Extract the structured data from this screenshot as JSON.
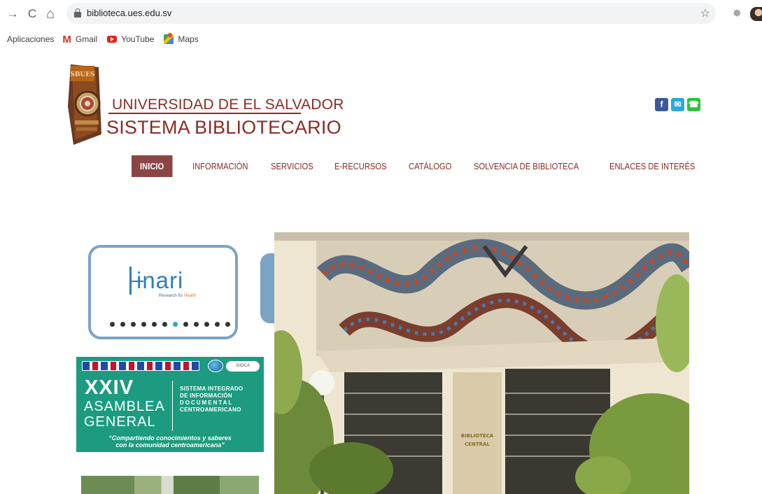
{
  "browser": {
    "url": "biblioteca.ues.edu.sv",
    "back_icon": "→",
    "reload_icon": "C",
    "home_icon": "⌂",
    "star_icon": "☆",
    "extension_icon": "✵"
  },
  "bookmarks": {
    "apps": "Aplicaciones",
    "gmail": "Gmail",
    "youtube": "YouTube",
    "maps": "Maps"
  },
  "header": {
    "line1": "UNIVERSIDAD DE EL SALVADOR",
    "line2": "SISTEMA BIBLIOTECARIO",
    "logo_text": "SBUES",
    "brand_color": "#8a2b23"
  },
  "social": {
    "facebook": "f",
    "mail": "✉",
    "phone": "☎"
  },
  "menu": [
    {
      "label": "INICIO",
      "active": true
    },
    {
      "label": "INFORMACIÓN",
      "active": false
    },
    {
      "label": "SERVICIOS",
      "active": false
    },
    {
      "label": "E-RECURSOS",
      "active": false
    },
    {
      "label": "CATÁLOGO",
      "active": false
    },
    {
      "label": "SOLVENCIA DE BIBLIOTECA",
      "active": false
    },
    {
      "label": "ENLACES DE INTERÉS",
      "active": false
    }
  ],
  "slider": {
    "logo": "inari",
    "tagline": "Research for",
    "tagline_highlight": "Health",
    "dot_count": 12,
    "active_dot": 7
  },
  "badge": {
    "number": "15"
  },
  "banner": {
    "edition": "XXIV",
    "word1": "ASAMBLEA",
    "word2": "GENERAL",
    "org_lines": [
      "SISTEMA INTEGRADO",
      "DE INFORMACIÓN",
      "DOCUMENTAL",
      "CENTROAMERICANO"
    ],
    "quote_lines": [
      "“Compartiendo conocimientos y saberes",
      "con la comunidad centroamericana”"
    ],
    "sidca": "SIIDCA"
  },
  "photo": {
    "sign_line1": "BIBLIOTECA",
    "sign_line2": "CENTRAL"
  }
}
